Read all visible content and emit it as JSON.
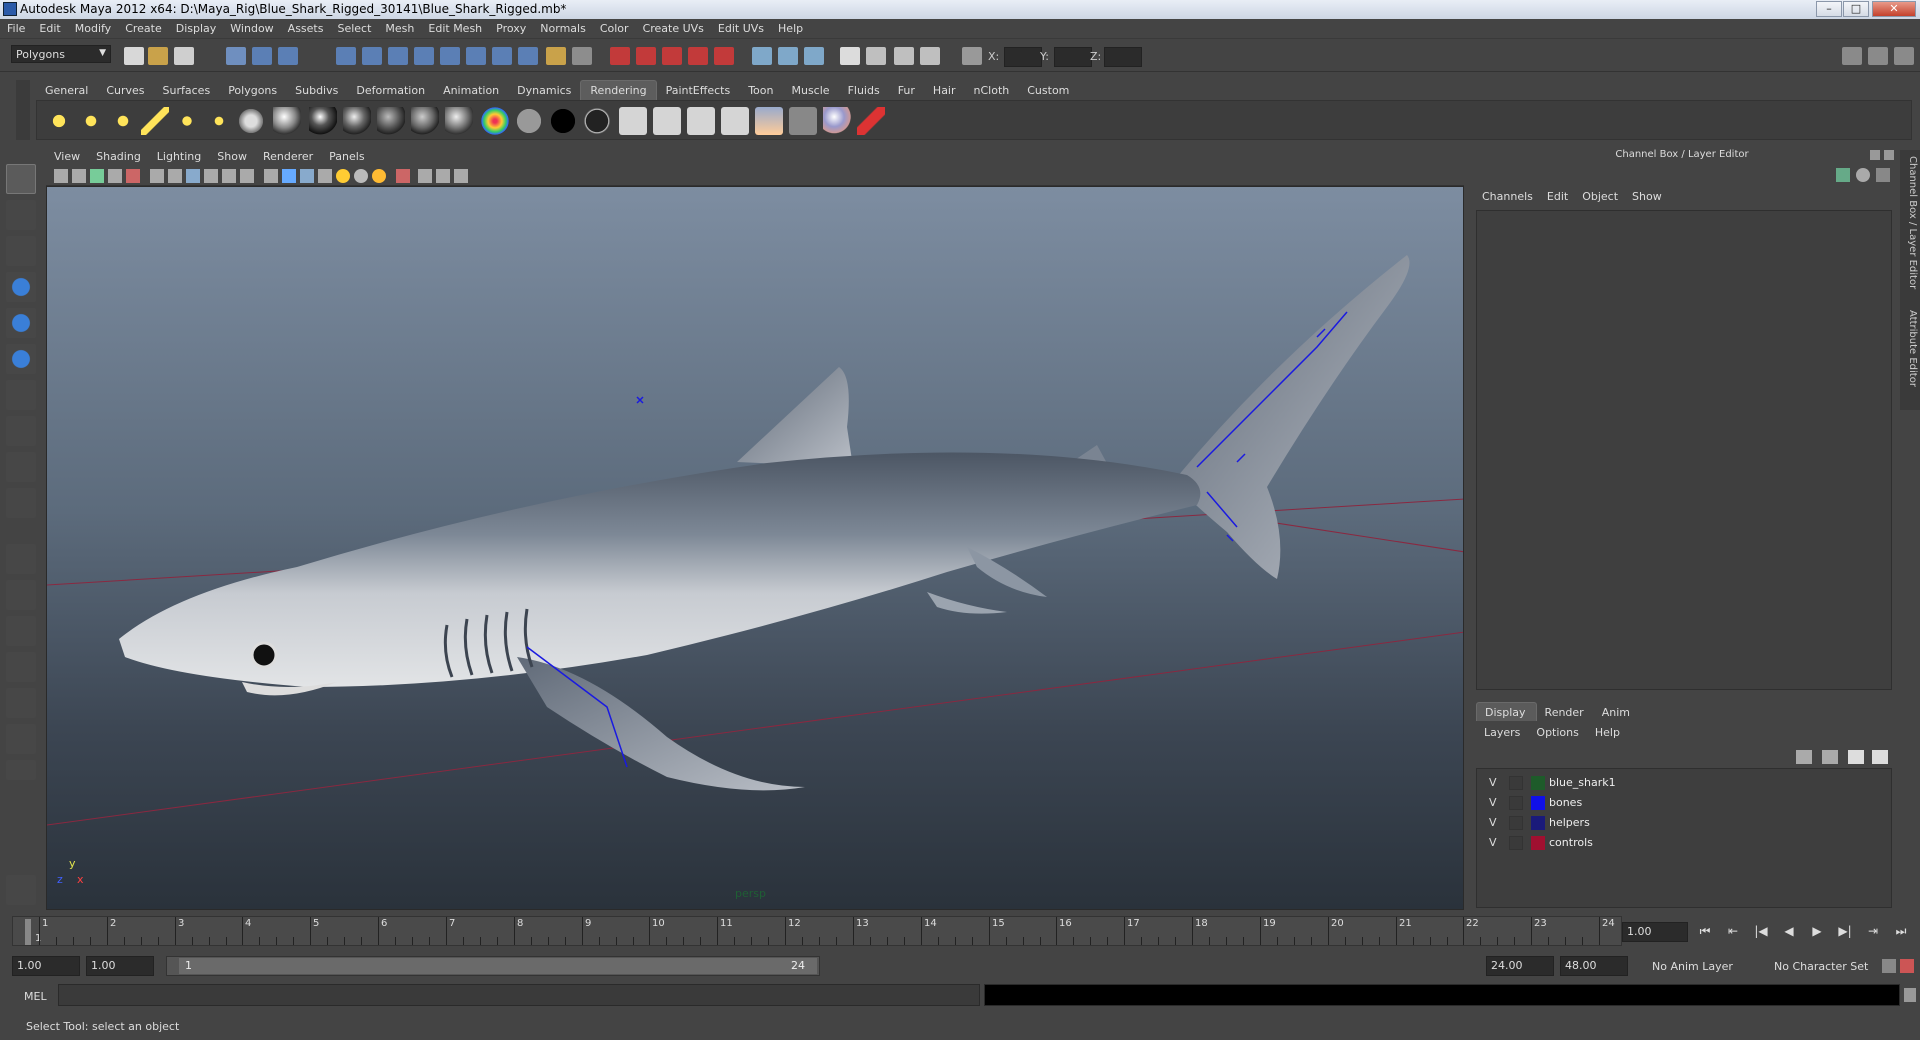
{
  "window": {
    "title": "Autodesk Maya 2012 x64: D:\\Maya_Rig\\Blue_Shark_Rigged_30141\\Blue_Shark_Rigged.mb*"
  },
  "menubar": [
    "File",
    "Edit",
    "Modify",
    "Create",
    "Display",
    "Window",
    "Assets",
    "Select",
    "Mesh",
    "Edit Mesh",
    "Proxy",
    "Normals",
    "Color",
    "Create UVs",
    "Edit UVs",
    "Help"
  ],
  "statusline": {
    "mode": "Polygons",
    "x_label": "X:",
    "y_label": "Y:",
    "z_label": "Z:"
  },
  "shelf": {
    "tabs": [
      "General",
      "Curves",
      "Surfaces",
      "Polygons",
      "Subdivs",
      "Deformation",
      "Animation",
      "Dynamics",
      "Rendering",
      "PaintEffects",
      "Toon",
      "Muscle",
      "Fluids",
      "Fur",
      "Hair",
      "nCloth",
      "Custom"
    ],
    "active_tab": "Rendering"
  },
  "viewport": {
    "menu": [
      "View",
      "Shading",
      "Lighting",
      "Show",
      "Renderer",
      "Panels"
    ],
    "camera_label": "persp",
    "axis": {
      "x": "x",
      "y": "y",
      "z": "z"
    }
  },
  "channel_box": {
    "title": "Channel Box / Layer Editor",
    "menu": [
      "Channels",
      "Edit",
      "Object",
      "Show"
    ]
  },
  "side_tabs": [
    "Channel Box / Layer Editor",
    "Attribute Editor"
  ],
  "layer_editor": {
    "tabs": [
      "Display",
      "Render",
      "Anim"
    ],
    "active_tab": "Display",
    "menu": [
      "Layers",
      "Options",
      "Help"
    ],
    "layers": [
      {
        "visible": "V",
        "name": "blue_shark1",
        "color": "#1e5b2a"
      },
      {
        "visible": "V",
        "name": "bones",
        "color": "#1010e8"
      },
      {
        "visible": "V",
        "name": "helpers",
        "color": "#1a1a7a"
      },
      {
        "visible": "V",
        "name": "controls",
        "color": "#a01030"
      }
    ]
  },
  "timeline": {
    "start_frame_label": "1",
    "ticks": [
      "1",
      "2",
      "3",
      "4",
      "5",
      "6",
      "7",
      "8",
      "9",
      "10",
      "11",
      "12",
      "13",
      "14",
      "15",
      "16",
      "17",
      "18",
      "19",
      "20",
      "21",
      "22",
      "23",
      "24"
    ],
    "current_frame": "1.00"
  },
  "range": {
    "start_time": "1.00",
    "playback_start": "1.00",
    "slider_start": "1",
    "slider_end": "24",
    "playback_end": "24.00",
    "end_time": "48.00",
    "anim_layer": "No Anim Layer",
    "character_set": "No Character Set"
  },
  "command_line": {
    "label": "MEL"
  },
  "help_line": {
    "text": "Select Tool: select an object"
  }
}
